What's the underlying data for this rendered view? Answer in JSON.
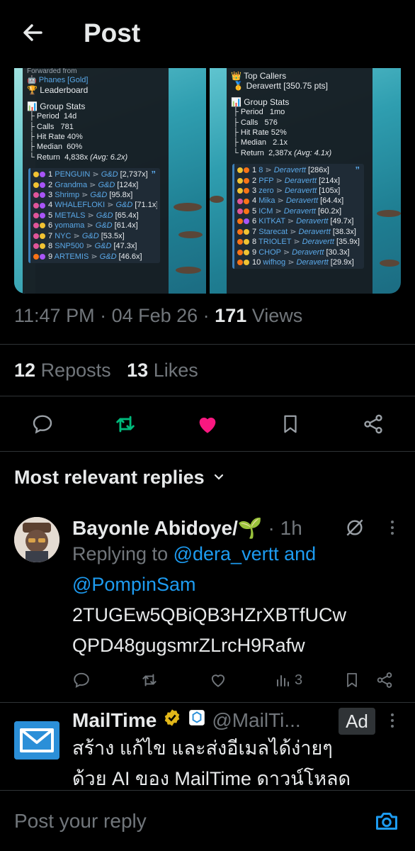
{
  "header": {
    "title": "Post"
  },
  "media": {
    "left": {
      "forwarded": "Forwarded from",
      "source": "Phanes [Gold]",
      "board": "Leaderboard",
      "stats_title": "Group Stats",
      "period_label": "Period",
      "period": "14d",
      "calls_label": "Calls",
      "calls": "781",
      "hit_label": "Hit Rate",
      "hit": "40%",
      "median_label": "Median",
      "median": "60%",
      "return_label": "Return",
      "return_val": "4,838x",
      "return_avg": "(Avg: 6.2x)",
      "rows": [
        {
          "n": "1",
          "name": "PENGUIN",
          "by": "G&D",
          "x": "[2,737x]"
        },
        {
          "n": "2",
          "name": "Grandma",
          "by": "G&D",
          "x": "[124x]"
        },
        {
          "n": "3",
          "name": "Shrimp",
          "by": "G&D",
          "x": "[95.8x]"
        },
        {
          "n": "4",
          "name": "WHALEFLOKI",
          "by": "G&D",
          "x": "[71.1x]"
        },
        {
          "n": "5",
          "name": "METALS",
          "by": "G&D",
          "x": "[65.4x]"
        },
        {
          "n": "6",
          "name": "yomama",
          "by": "G&D",
          "x": "[61.4x]"
        },
        {
          "n": "7",
          "name": "NYC",
          "by": "G&D",
          "x": "[53.5x]"
        },
        {
          "n": "8",
          "name": "SNP500",
          "by": "G&D",
          "x": "[47.3x]"
        },
        {
          "n": "9",
          "name": "ARTEMIS",
          "by": "G&D",
          "x": "[46.6x]"
        }
      ]
    },
    "right": {
      "top_callers": "Top Callers",
      "top_name": "Deravertt [350.75 pts]",
      "stats_title": "Group Stats",
      "period_label": "Period",
      "period": "1mo",
      "calls_label": "Calls",
      "calls": "576",
      "hit_label": "Hit Rate",
      "hit": "52%",
      "median_label": "Median",
      "median": "2.1x",
      "return_label": "Return",
      "return_val": "2,387x",
      "return_avg": "(Avg: 4.1x)",
      "rows": [
        {
          "n": "1",
          "name": "8",
          "by": "Deravertt",
          "x": "[286x]"
        },
        {
          "n": "2",
          "name": "PFP",
          "by": "Deravertt",
          "x": "[214x]"
        },
        {
          "n": "3",
          "name": "zero",
          "by": "Deravertt",
          "x": "[105x]"
        },
        {
          "n": "4",
          "name": "Mika",
          "by": "Deravertt",
          "x": "[64.4x]"
        },
        {
          "n": "5",
          "name": "ICM",
          "by": "Deravertt",
          "x": "[60.2x]"
        },
        {
          "n": "6",
          "name": "KITKAT",
          "by": "Deravertt",
          "x": "[49.7x]"
        },
        {
          "n": "7",
          "name": "Starecat",
          "by": "Deravertt",
          "x": "[38.3x]"
        },
        {
          "n": "8",
          "name": "TRIOLET",
          "by": "Deravertt",
          "x": "[35.9x]"
        },
        {
          "n": "9",
          "name": "CHOP",
          "by": "Deravertt",
          "x": "[30.3x]"
        },
        {
          "n": "10",
          "name": "wifhog",
          "by": "Deravertt",
          "x": "[29.9x]"
        }
      ]
    }
  },
  "meta": {
    "time": "11:47 PM",
    "date": "04 Feb 26",
    "views_count": "171",
    "views_label": "Views"
  },
  "stats": {
    "reposts_count": "12",
    "reposts_label": "Reposts",
    "likes_count": "13",
    "likes_label": "Likes"
  },
  "replies_header": "Most relevant replies",
  "reply": {
    "name": "Bayonle Abidoye/🌱",
    "time": "· 1h",
    "replying_to": "Replying to",
    "mention1": "@dera_vertt",
    "and": "and",
    "mention2": "@PompinSam",
    "text_line1": "2TUGEw5QBiQB3HZrXBTfUCw",
    "text_line2": "QPD48gugsmrZLrcH9Rafw",
    "views": "3"
  },
  "ad": {
    "name": "MailTime",
    "handle": "@MailTi...",
    "badge": "Ad",
    "text_line1": "สร้าง แก้ไข และส่งอีเมลได้ง่ายๆ",
    "text_line2": "ด้วย AI ของ MailTime ดาวน์โหลด"
  },
  "composer": {
    "placeholder": "Post your reply"
  },
  "colors": {
    "accent": "#1d9bf0",
    "repost_green": "#00ba7c",
    "like_pink": "#f91880",
    "muted": "#71767b"
  }
}
